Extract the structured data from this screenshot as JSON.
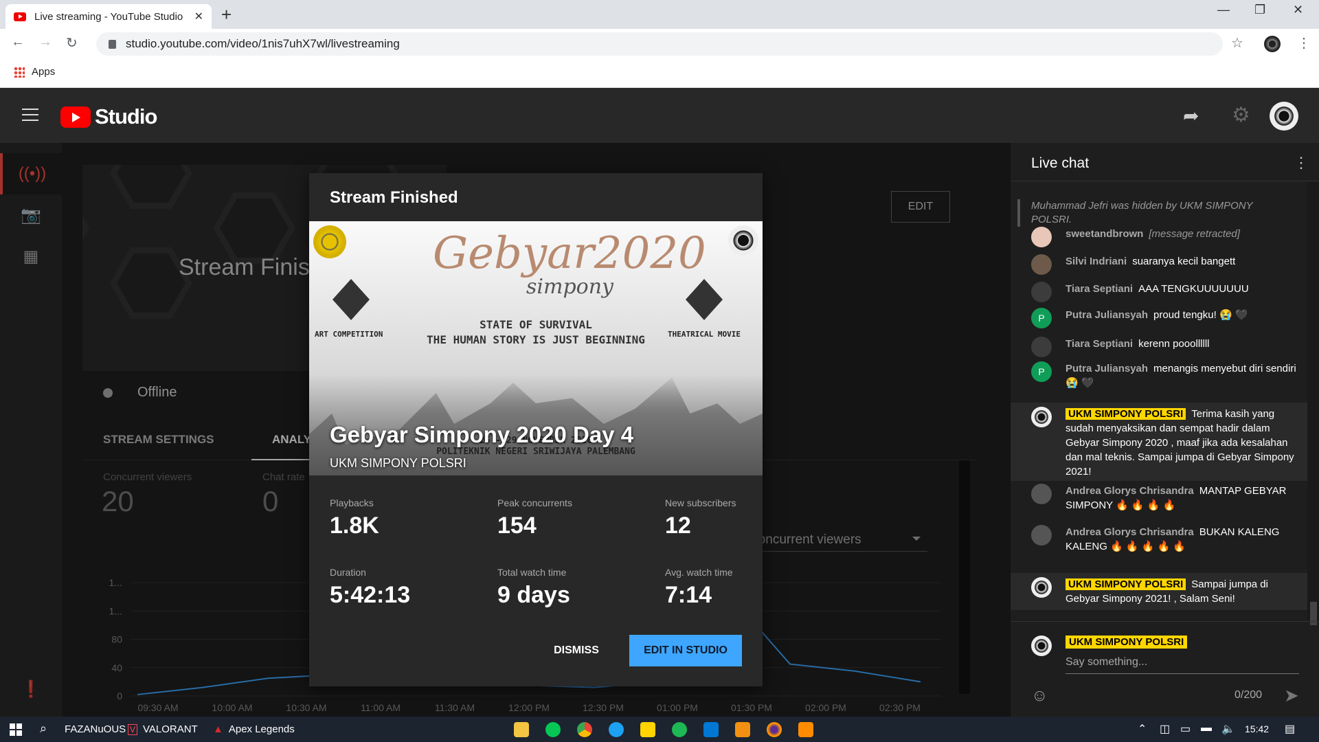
{
  "browser": {
    "tab_title": "Live streaming - YouTube Studio",
    "url": "studio.youtube.com/video/1nis7uhX7wl/livestreaming",
    "bookmark_apps": "Apps"
  },
  "studio": {
    "logo_text": "Studio"
  },
  "main": {
    "preview_text": "Stream Finis",
    "status": "Offline",
    "edit_label": "EDIT",
    "tabs": [
      {
        "label": "STREAM SETTINGS"
      },
      {
        "label": "ANALYTICS"
      }
    ],
    "metrics": [
      {
        "label": "Concurrent viewers",
        "value": "20"
      },
      {
        "label": "Chat rate",
        "value": "0"
      }
    ],
    "chart_select": "Concurrent viewers"
  },
  "chart_data": {
    "type": "line",
    "x": [
      "09:30 AM",
      "10:00 AM",
      "10:30 AM",
      "11:00 AM",
      "11:30 AM",
      "12:00 PM",
      "12:30 PM",
      "01:00 PM",
      "01:30 PM",
      "02:00 PM",
      "02:30 PM"
    ],
    "y_ticks": [
      "0",
      "40",
      "80",
      "1...",
      "1..."
    ],
    "series": [
      {
        "values": [
          2,
          12,
          25,
          30,
          28,
          18,
          15,
          12,
          20,
          150,
          45,
          35,
          20
        ]
      }
    ],
    "ylim": [
      0,
      160
    ],
    "grid": true,
    "color": "#3ea6ff"
  },
  "modal": {
    "title": "Stream Finished",
    "thumbnail": {
      "headline": "Gebyar2020",
      "sub": "simpony",
      "tagline_1": "STATE OF SURVIVAL",
      "tagline_2": "THE HUMAN STORY IS JUST BEGINNING",
      "left_caption": "ART COMPETITION",
      "right_caption": "THEATRICAL MOVIE",
      "dates": "26 - 29 NOVEMBER 2020",
      "venue": "POLITEKNIK NEGERI SRIWIJAYA PALEMBANG"
    },
    "video_title": "Gebyar Simpony 2020 Day 4",
    "channel": "UKM SIMPONY POLSRI",
    "stats": [
      {
        "label": "Playbacks",
        "value": "1.8K"
      },
      {
        "label": "Peak concurrents",
        "value": "154"
      },
      {
        "label": "New subscribers",
        "value": "12"
      },
      {
        "label": "Duration",
        "value": "5:42:13"
      },
      {
        "label": "Total watch time",
        "value": "9 days"
      },
      {
        "label": "Avg. watch time",
        "value": "7:14"
      }
    ],
    "dismiss_label": "DISMISS",
    "edit_label": "EDIT IN STUDIO"
  },
  "chat": {
    "title": "Live chat",
    "hidden_notice": "Muhammad Jefri was hidden by UKM SIMPONY POLSRI.",
    "messages": [
      {
        "author": "sweetandbrown",
        "text": "[message retracted]",
        "avatar_color": "#e8c6b8"
      },
      {
        "author": "Silvi Indriani",
        "text": "suaranya kecil bangett",
        "avatar_color": "#6d5a4a"
      },
      {
        "author": "Tiara Septiani",
        "text": "AAA TENGKUUUUUUU",
        "avatar_color": "#3c3c3c"
      },
      {
        "author": "Putra Juliansyah",
        "text": "proud tengku! 😭 🖤",
        "avatar_color": "#0f9d58",
        "avatar_letter": "P"
      },
      {
        "author": "Tiara Septiani",
        "text": "kerenn pooollllll",
        "avatar_color": "#3c3c3c"
      },
      {
        "author": "Putra Juliansyah",
        "text": "menangis menyebut diri sendiri 😭 🖤",
        "avatar_color": "#0f9d58",
        "avatar_letter": "P"
      },
      {
        "author": "UKM SIMPONY POLSRI",
        "owner": true,
        "text": "Terima kasih yang sudah menyaksikan dan sempat hadir dalam Gebyar Simpony 2020 , maaf jika ada kesalahan dan mal teknis. Sampai jumpa di Gebyar Simpony 2021!"
      },
      {
        "author": "Andrea Glorys Chrisandra",
        "text": "MANTAP GEBYAR SIMPONY 🔥 🔥 🔥 🔥",
        "avatar_color": "#555"
      },
      {
        "author": "Andrea Glorys Chrisandra",
        "text": "BUKAN KALENG KALENG 🔥 🔥 🔥 🔥 🔥",
        "avatar_color": "#555"
      },
      {
        "author": "UKM SIMPONY POLSRI",
        "owner": true,
        "text": "Sampai jumpa di Gebyar Simpony 2021! , Salam Seni!"
      }
    ],
    "input_name": "UKM SIMPONY POLSRI",
    "placeholder": "Say something...",
    "char_count": "0/200"
  },
  "taskbar": {
    "items": [
      "FAZANuOUS",
      "VALORANT",
      "Apex Legends"
    ],
    "clock": "15:42"
  }
}
